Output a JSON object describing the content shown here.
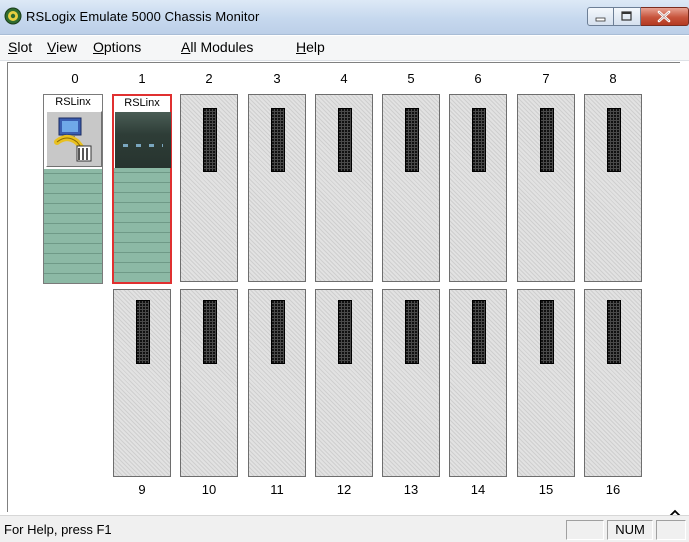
{
  "window": {
    "title": "RSLogix Emulate 5000 Chassis Monitor",
    "icon": "rslogix-emulate-icon",
    "controls": [
      "minimize-icon",
      "maximize-icon",
      "close-icon"
    ]
  },
  "menu": {
    "items": [
      {
        "label": "Slot",
        "accel": "S",
        "rest": "lot"
      },
      {
        "label": "View",
        "accel": "V",
        "rest": "iew"
      },
      {
        "label": "Options",
        "accel": "O",
        "rest": "ptions"
      },
      {
        "label": "All Modules",
        "accel": "A",
        "rest": "ll Modules"
      },
      {
        "label": "Help",
        "accel": "H",
        "rest": "elp"
      }
    ]
  },
  "chassis": {
    "top_slots": [
      "0",
      "1",
      "2",
      "3",
      "4",
      "5",
      "6",
      "7",
      "8"
    ],
    "bottom_slots": [
      "9",
      "10",
      "11",
      "12",
      "13",
      "14",
      "15",
      "16"
    ],
    "modules": [
      {
        "slot": "0",
        "label": "RSLinx",
        "icon": "rslinx-module-icon",
        "selected": false
      },
      {
        "slot": "1",
        "label": "RSLinx",
        "icon": "module-faceplate",
        "selected": true
      }
    ],
    "selection_color": "#e03030",
    "module_color": "#8cb9a5"
  },
  "statusbar": {
    "help_text": "For Help, press F1",
    "pane1": "",
    "pane2": "NUM",
    "pane3": ""
  }
}
